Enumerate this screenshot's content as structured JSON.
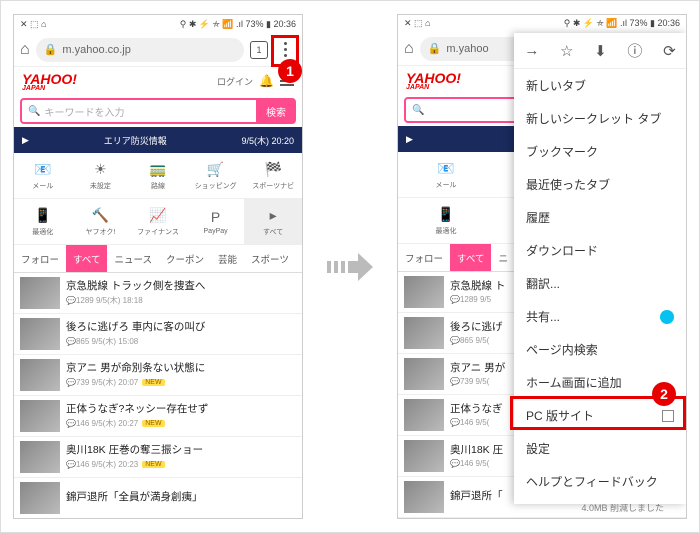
{
  "statusbar": {
    "left_icons": "✕ ⬚ ⌂",
    "right": "⚲ ✱ ⚡ ⛤ 📶 .ıl 73% ▮ 20:36"
  },
  "address": {
    "url": "m.yahoo.co.jp",
    "url_truncated": "m.yahoo",
    "tab_count": "1"
  },
  "yahoo": {
    "logo": "YAHOO!",
    "logo_sub": "JAPAN",
    "login": "ログイン"
  },
  "search": {
    "placeholder": "キーワードを入力",
    "button": "検索",
    "icon": "🔍"
  },
  "alert": {
    "text": "エリア防災情報",
    "time": "9/5(木) 20:20",
    "play": "▶"
  },
  "icons_row1": [
    {
      "label": "メール",
      "ic": "📧"
    },
    {
      "label": "天気",
      "ic": "☀",
      "sub": "未設定"
    },
    {
      "label": "路線",
      "ic": "🚃"
    },
    {
      "label": "ショッピング",
      "ic": "🛒"
    },
    {
      "label": "スポーツナビ",
      "ic": "🏁"
    }
  ],
  "icons_row2": [
    {
      "label": "最適化",
      "ic": "📱"
    },
    {
      "label": "ヤフオク!",
      "ic": "🔨"
    },
    {
      "label": "ファイナンス",
      "ic": "📈"
    },
    {
      "label": "PayPay",
      "ic": "P"
    },
    {
      "label": "すべて",
      "ic": "▸"
    }
  ],
  "tabs": [
    "フォロー",
    "すべて",
    "ニュース",
    "クーポン",
    "芸能",
    "スポーツ"
  ],
  "tabs2": [
    "フォロー",
    "すべて",
    "ニ"
  ],
  "active_tab": 1,
  "news": [
    {
      "title": "京急脱線 トラック側を捜査へ",
      "meta": "💬1289 9/5(木) 18:18",
      "new": false
    },
    {
      "title": "後ろに逃げろ 車内に客の叫び",
      "meta": "💬865 9/5(木) 15:08",
      "new": false
    },
    {
      "title": "京アニ 男が命別条ない状態に",
      "meta": "💬739 9/5(木) 20:07",
      "new": true
    },
    {
      "title": "正体うなぎ?ネッシー存在せず",
      "meta": "💬146 9/5(木) 20:27",
      "new": true
    },
    {
      "title": "奥川18K 圧巻の奪三振ショー",
      "meta": "💬146 9/5(木) 20:23",
      "new": true
    },
    {
      "title": "錦戸退所「全員が満身創痍」",
      "meta": "",
      "new": false
    }
  ],
  "news2": [
    {
      "title": "京急脱線 ト",
      "meta": "💬1289 9/5"
    },
    {
      "title": "後ろに逃げ",
      "meta": "💬865 9/5("
    },
    {
      "title": "京アニ 男が",
      "meta": "💬739 9/5("
    },
    {
      "title": "正体うなぎ",
      "meta": "💬146 9/5("
    },
    {
      "title": "奥川18K 圧",
      "meta": "💬146 9/5("
    },
    {
      "title": "錦戸退所「",
      "meta": ""
    }
  ],
  "menu_top": [
    "→",
    "☆",
    "⬇",
    "ⓘ",
    "⟳"
  ],
  "menu_items": [
    {
      "label": "新しいタブ"
    },
    {
      "label": "新しいシークレット タブ"
    },
    {
      "label": "ブックマーク"
    },
    {
      "label": "最近使ったタブ"
    },
    {
      "label": "履歴"
    },
    {
      "label": "ダウンロード"
    },
    {
      "label": "翻訳..."
    },
    {
      "label": "共有...",
      "cast": true
    },
    {
      "label": "ページ内検索"
    },
    {
      "label": "ホーム画面に追加"
    },
    {
      "label": "PC 版サイト",
      "checkbox": true
    },
    {
      "label": "設定"
    },
    {
      "label": "ヘルプとフィードバック"
    }
  ],
  "footnote": "4.0MB 削減しました",
  "badges": {
    "one": "1",
    "two": "2"
  }
}
